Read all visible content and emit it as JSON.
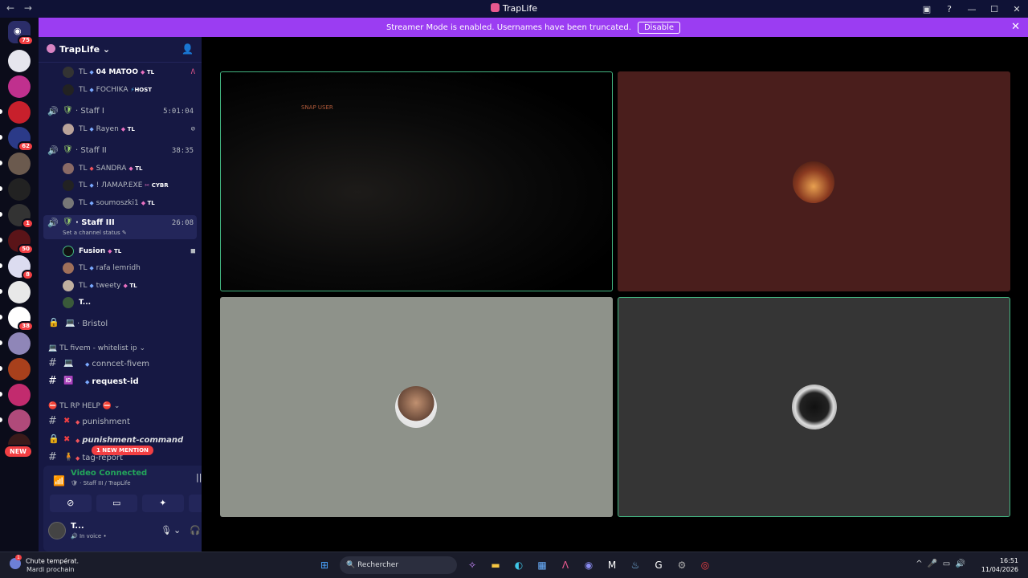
{
  "window": {
    "title": "TrapLife",
    "nav_back": "←",
    "nav_forward": "→"
  },
  "banner": {
    "text": "Streamer Mode is enabled. Usernames have been truncated.",
    "disable_label": "Disable"
  },
  "guilds": {
    "home_badge": "75",
    "badges": [
      "62",
      "1",
      "50",
      "8",
      "38"
    ],
    "new_label": "NEW"
  },
  "server": {
    "name": "TrapLife",
    "chevron": "⌄"
  },
  "members_top": [
    {
      "prefix": "TL",
      "name": "04 MATOO",
      "tag": "TL",
      "right": "Λ"
    },
    {
      "prefix": "TL",
      "name": "FOCHIKA",
      "tag": "HOST"
    }
  ],
  "voice_channels": [
    {
      "name": "Staff I",
      "time": "5:01:04"
    },
    {
      "name": "Staff II",
      "time": "38:35"
    },
    {
      "name": "Staff III",
      "time": "26:08",
      "status": "Set a channel status"
    }
  ],
  "staff1_members": [
    {
      "prefix": "TL",
      "name": "Rayen",
      "tag": "TL"
    }
  ],
  "staff2_members": [
    {
      "prefix": "TL",
      "name": "SANDRA",
      "tag": "TL"
    },
    {
      "prefix": "TL",
      "name": "! ЛAMAP.EXE",
      "tag": "CYBR"
    },
    {
      "prefix": "TL",
      "name": "soumoszki1",
      "tag": "TL"
    }
  ],
  "staff3_members": [
    {
      "name": "Fusion",
      "tag": "TL"
    },
    {
      "prefix": "TL",
      "name": "rafa lemridh"
    },
    {
      "prefix": "TL",
      "name": "tweety",
      "tag": "TL"
    },
    {
      "name": "T..."
    }
  ],
  "locked_channel": "Bristol",
  "categories": {
    "fivem": "TL fivem - whitelist ip",
    "rphelp": "TL RP HELP"
  },
  "text_channels": {
    "connect": "conncet-fivem",
    "request": "request-id",
    "punishment": "punishment",
    "punishment_cmd": "punishment-command",
    "tag_report": "tag-report"
  },
  "mention_label": "1 NEW MENTION",
  "voice_panel": {
    "status": "Video Connected",
    "sub": "Staff III / TrapLife"
  },
  "user": {
    "name": "T...",
    "status": "In voice"
  },
  "stage": {
    "tile1_text": "SNAP USER"
  },
  "taskbar": {
    "weather_line1": "Chute températ.",
    "weather_line2": "Mardi prochain",
    "weather_badge": "1",
    "search": "Rechercher",
    "time": "16:51",
    "date": "11/04/2026"
  },
  "colors": {
    "banner": "#9b3df2",
    "speaking": "#43b581",
    "accent": "#f23f43"
  }
}
